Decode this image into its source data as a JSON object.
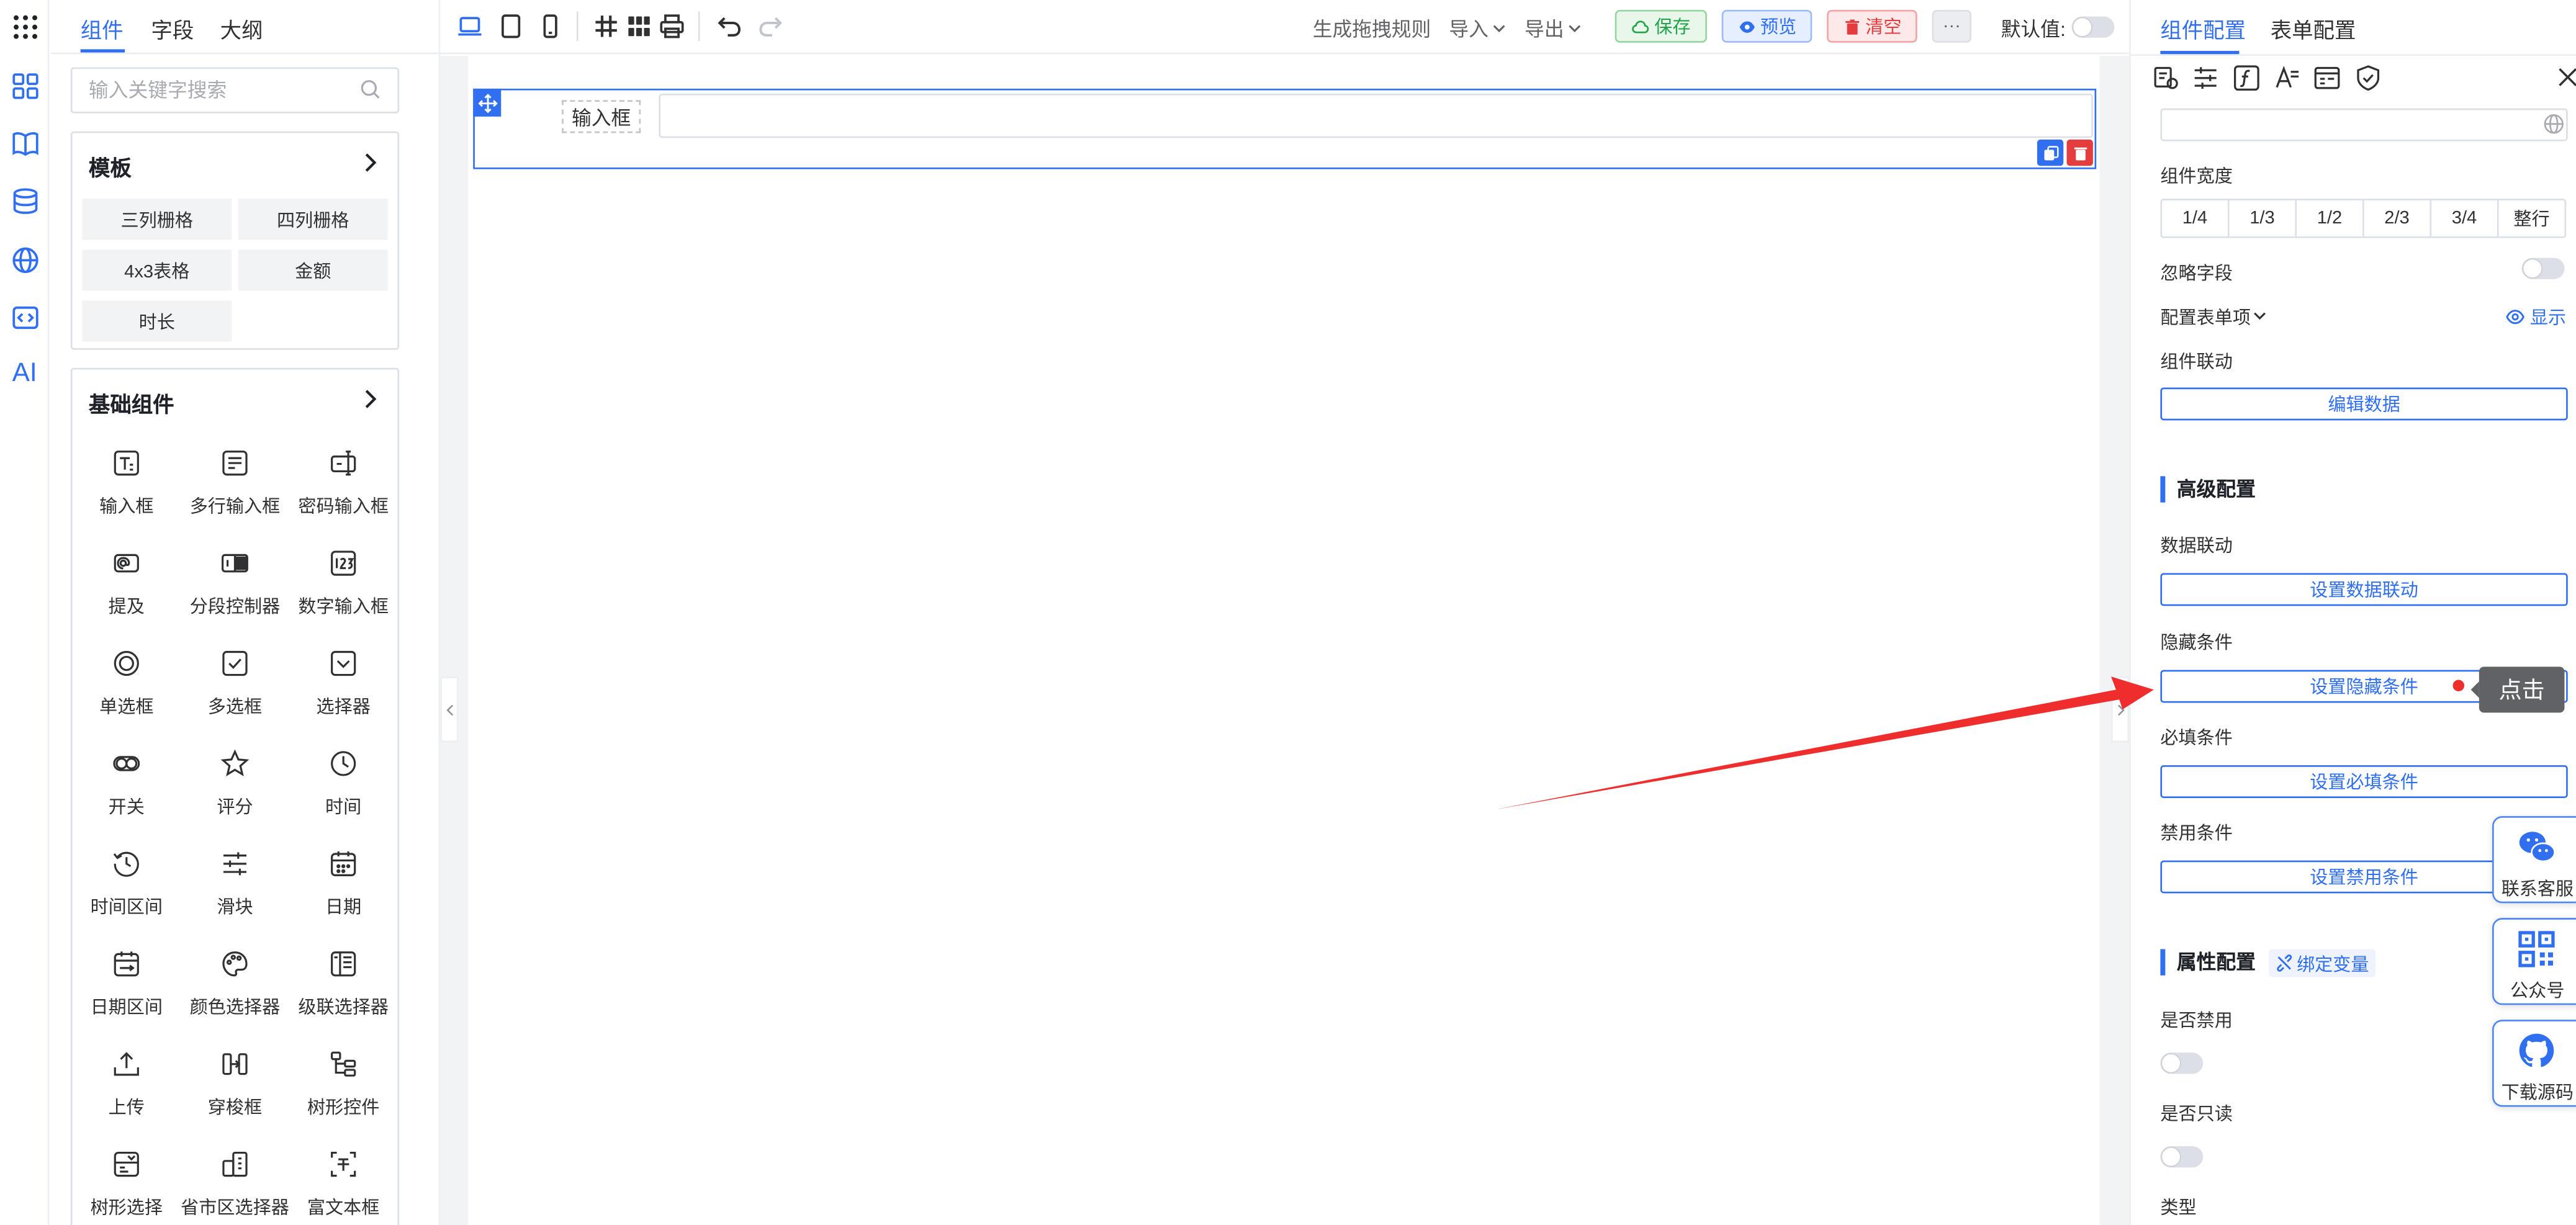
{
  "rail": {
    "ai_label": "AI",
    "icons": [
      "apps-grid-icon",
      "components-icon",
      "book-icon",
      "database-icon",
      "globe-icon",
      "code-icon"
    ]
  },
  "components_panel": {
    "tabs": [
      {
        "label": "组件",
        "active": true
      },
      {
        "label": "字段",
        "active": false
      },
      {
        "label": "大纲",
        "active": false
      }
    ],
    "search": {
      "placeholder": "输入关键字搜索",
      "value": ""
    },
    "templates": {
      "title": "模板",
      "items": [
        "三列栅格",
        "四列栅格",
        "4x3表格",
        "金额",
        "时长"
      ]
    },
    "basic": {
      "title": "基础组件",
      "items": [
        {
          "label": "输入框",
          "icon": "text-input-icon"
        },
        {
          "label": "多行输入框",
          "icon": "textarea-icon"
        },
        {
          "label": "密码输入框",
          "icon": "password-icon"
        },
        {
          "label": "提及",
          "icon": "mention-icon"
        },
        {
          "label": "分段控制器",
          "icon": "segmented-icon"
        },
        {
          "label": "数字输入框",
          "icon": "number-icon"
        },
        {
          "label": "单选框",
          "icon": "radio-icon"
        },
        {
          "label": "多选框",
          "icon": "checkbox-icon"
        },
        {
          "label": "选择器",
          "icon": "select-icon"
        },
        {
          "label": "开关",
          "icon": "switch-icon"
        },
        {
          "label": "评分",
          "icon": "star-icon"
        },
        {
          "label": "时间",
          "icon": "clock-icon"
        },
        {
          "label": "时间区间",
          "icon": "time-range-icon"
        },
        {
          "label": "滑块",
          "icon": "slider-icon"
        },
        {
          "label": "日期",
          "icon": "calendar-icon"
        },
        {
          "label": "日期区间",
          "icon": "date-range-icon"
        },
        {
          "label": "颜色选择器",
          "icon": "palette-icon"
        },
        {
          "label": "级联选择器",
          "icon": "cascader-icon"
        },
        {
          "label": "上传",
          "icon": "upload-icon"
        },
        {
          "label": "穿梭框",
          "icon": "transfer-icon"
        },
        {
          "label": "树形控件",
          "icon": "tree-icon"
        },
        {
          "label": "树形选择",
          "icon": "tree-select-icon"
        },
        {
          "label": "省市区选择器",
          "icon": "region-icon"
        },
        {
          "label": "富文本框",
          "icon": "rich-text-icon"
        }
      ]
    }
  },
  "toolbar": {
    "generate_rule": "生成拖拽规则",
    "import": "导入",
    "export": "导出",
    "save": "保存",
    "preview": "预览",
    "clear": "清空",
    "more": "···",
    "default_value_label": "默认值:",
    "default_value_on": false
  },
  "canvas": {
    "field_label": "输入框",
    "field_value": ""
  },
  "config_panel": {
    "tabs": [
      {
        "label": "组件配置",
        "active": true
      },
      {
        "label": "表单配置",
        "active": false
      }
    ],
    "width_label": "组件宽度",
    "width_options": [
      "1/4",
      "1/3",
      "1/2",
      "2/3",
      "3/4",
      "整行"
    ],
    "ignore_field_label": "忽略字段",
    "ignore_field_on": false,
    "config_items_label": "配置表单项",
    "show_label": "显示",
    "linkage_label": "组件联动",
    "edit_data_button": "编辑数据",
    "advanced_title": "高级配置",
    "data_linkage_label": "数据联动",
    "data_linkage_button": "设置数据联动",
    "hide_cond_label": "隐藏条件",
    "hide_cond_button": "设置隐藏条件",
    "required_cond_label": "必填条件",
    "required_cond_button": "设置必填条件",
    "disabled_cond_label": "禁用条件",
    "disabled_cond_button": "设置禁用条件",
    "props_title": "属性配置",
    "bind_variable": "绑定变量",
    "is_disabled_label": "是否禁用",
    "is_disabled_on": false,
    "is_readonly_label": "是否只读",
    "is_readonly_on": false,
    "type_label": "类型"
  },
  "floating": {
    "service": "联系客服",
    "official": "公众号",
    "download": "下载源码"
  },
  "annotation": {
    "tooltip": "点击"
  },
  "colors": {
    "accent": "#2f6ff0",
    "save": "#22a34a",
    "clear": "#e43d3d",
    "arrow": "#f02d2d"
  }
}
